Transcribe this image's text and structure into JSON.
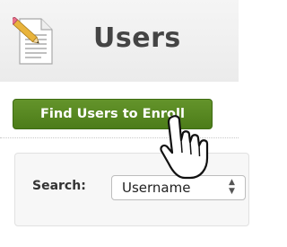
{
  "header": {
    "title": "Users",
    "icon": "notepad-pencil-icon"
  },
  "actions": {
    "find_users_label": "Find Users to Enroll"
  },
  "search": {
    "label": "Search:",
    "field_value": "Username"
  },
  "cursor": {
    "icon": "hand-pointer-icon"
  },
  "colors": {
    "button_green": "#5a8a24",
    "title_gray": "#444444"
  }
}
